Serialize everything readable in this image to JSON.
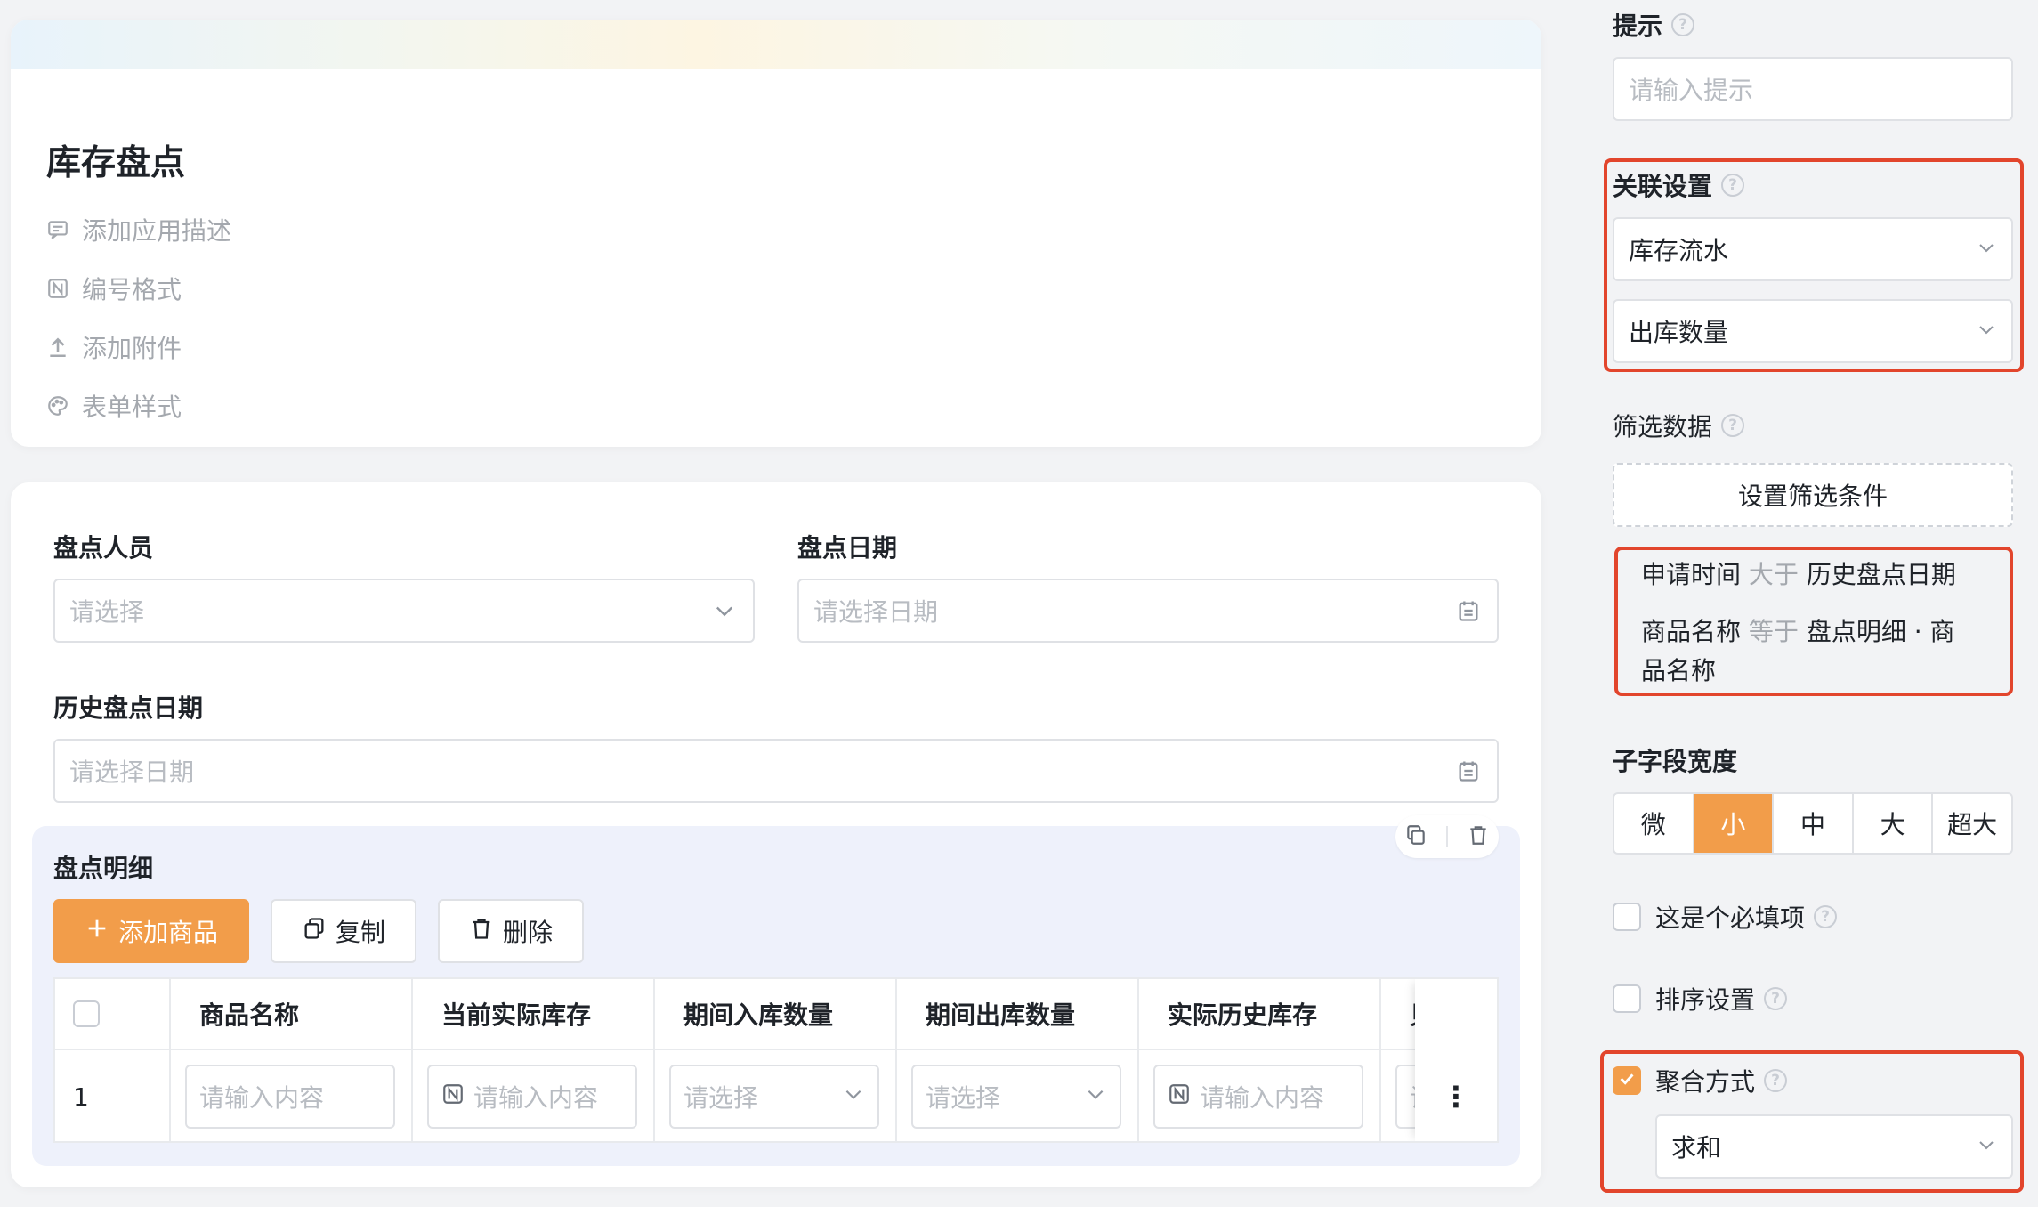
{
  "app": {
    "title": "库存盘点",
    "meta_items": [
      {
        "icon": "comment-icon",
        "label": "添加应用描述"
      },
      {
        "icon": "number-format-icon",
        "label": "编号格式"
      },
      {
        "icon": "upload-icon",
        "label": "添加附件"
      },
      {
        "icon": "palette-icon",
        "label": "表单样式"
      }
    ]
  },
  "form": {
    "fields": [
      {
        "label": "盘点人员",
        "placeholder": "请选择"
      },
      {
        "label": "盘点日期",
        "placeholder": "请选择日期"
      },
      {
        "label": "历史盘点日期",
        "placeholder": "请选择日期"
      }
    ],
    "subtable": {
      "title": "盘点明细",
      "buttons": {
        "add": "添加商品",
        "copy": "复制",
        "delete": "删除"
      },
      "columns": [
        "商品名称",
        "当前实际库存",
        "期间入库数量",
        "期间出库数量",
        "实际历史库存",
        "贝"
      ],
      "row": {
        "index": "1",
        "cells": [
          "请输入内容",
          "请输入内容",
          "请选择",
          "请选择",
          "请输入内容",
          "请"
        ]
      },
      "more": "⋮"
    }
  },
  "sidebar": {
    "hint": {
      "label": "提示",
      "placeholder": "请输入提示"
    },
    "relation": {
      "label": "关联设置",
      "form": "库存流水",
      "field": "出库数量"
    },
    "filter": {
      "label": "筛选数据",
      "button": "设置筛选条件",
      "conditions": [
        {
          "field": "申请时间",
          "op": "大于",
          "value": "历史盘点日期"
        },
        {
          "field": "商品名称",
          "op": "等于",
          "value": "盘点明细 · 商",
          "value_cont": "品名称"
        }
      ]
    },
    "width": {
      "label": "子字段宽度",
      "options": [
        "微",
        "小",
        "中",
        "大",
        "超大"
      ],
      "selected": "小"
    },
    "required": {
      "label": "这是个必填项",
      "checked": false
    },
    "sort": {
      "label": "排序设置",
      "checked": false
    },
    "aggregate": {
      "label": "聚合方式",
      "checked": true,
      "value": "求和"
    }
  },
  "colors": {
    "accent": "#f29d4a",
    "highlight_border": "#e2452c"
  }
}
